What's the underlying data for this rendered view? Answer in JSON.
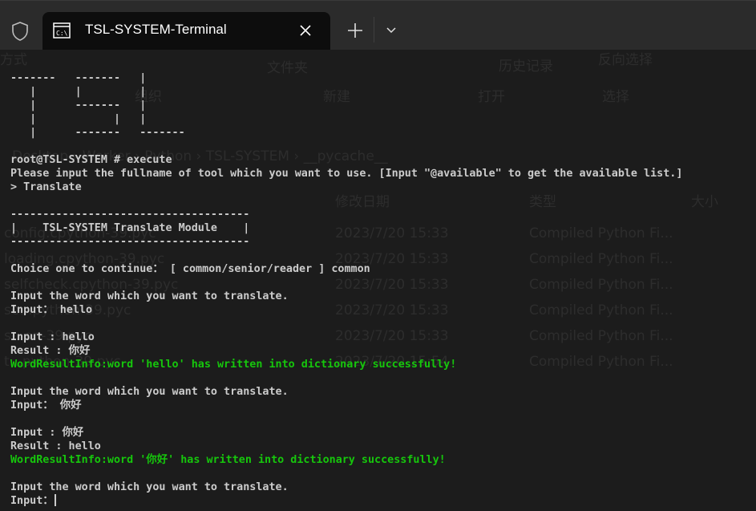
{
  "window": {
    "tab_title": "TSL-SYSTEM-Terminal",
    "tab_icon": "cmd-icon",
    "colors": {
      "green": "#16c60c",
      "text": "#cccccc",
      "background": "#1c1c1c",
      "tabbar": "#2b2b2b",
      "active_tab": "#0d0d0d"
    }
  },
  "background_window": {
    "ribbon": [
      "方式",
      "文件夹",
      "历史记录",
      "反向选择",
      "组织",
      "新建",
      "打开",
      "选择"
    ],
    "breadcrumb": "Desktop  ›  Worker  ›  Python  ›  TSL-SYSTEM  ›  __pycache__",
    "columns": [
      "修改日期",
      "类型",
      "大小"
    ],
    "files": [
      {
        "name": "config.cpython-39.pyc",
        "date": "2023/7/20 15:33",
        "type": "Compiled Python Fi..."
      },
      {
        "name": "loading.cpython-39.pyc",
        "date": "2023/7/20 15:33",
        "type": "Compiled Python Fi..."
      },
      {
        "name": "selfcheck.cpython-39.pyc",
        "date": "2023/7/20 15:33",
        "type": "Compiled Python Fi..."
      },
      {
        "name": "se...python-39.pyc",
        "date": "2023/7/20 15:33",
        "type": "Compiled Python Fi..."
      },
      {
        "name": "s...on-39.pyc",
        "date": "2023/7/20 15:33",
        "type": "Compiled Python Fi..."
      },
      {
        "name": "t...python-39.pyc",
        "date": "2023/7/20 15:54",
        "type": "Compiled Python Fi..."
      }
    ]
  },
  "terminal": {
    "lines": [
      {
        "text": "-------   -------   |",
        "color": "default"
      },
      {
        "text": "   |      |         |",
        "color": "default"
      },
      {
        "text": "   |      -------   |",
        "color": "default"
      },
      {
        "text": "   |            |   |",
        "color": "default"
      },
      {
        "text": "   |      -------   -------",
        "color": "default"
      },
      {
        "text": "",
        "color": "default"
      },
      {
        "text": "root@TSL-SYSTEM # execute",
        "color": "default"
      },
      {
        "text": "Please input the fullname of tool which you want to use. [Input \"@available\" to get the available list.]",
        "color": "default"
      },
      {
        "text": "> Translate",
        "color": "default"
      },
      {
        "text": "",
        "color": "default"
      },
      {
        "text": "-------------------------------------",
        "color": "default"
      },
      {
        "text": "|    TSL-SYSTEM Translate Module    |",
        "color": "default"
      },
      {
        "text": "-------------------------------------",
        "color": "default"
      },
      {
        "text": "",
        "color": "default"
      },
      {
        "text": "Choice one to continue： [ common/senior/reader ] common",
        "color": "default"
      },
      {
        "text": "",
        "color": "default"
      },
      {
        "text": "Input the word which you want to translate.",
        "color": "default"
      },
      {
        "text": "Input： hello",
        "color": "default"
      },
      {
        "text": "",
        "color": "default"
      },
      {
        "text": "Input : hello",
        "color": "default"
      },
      {
        "text": "Result : 你好",
        "color": "default"
      },
      {
        "text": "WordResultInfo:word 'hello' has written into dictionary successfully!",
        "color": "green"
      },
      {
        "text": "",
        "color": "default"
      },
      {
        "text": "Input the word which you want to translate.",
        "color": "default"
      },
      {
        "text": "Input： 你好",
        "color": "default"
      },
      {
        "text": "",
        "color": "default"
      },
      {
        "text": "Input : 你好",
        "color": "default"
      },
      {
        "text": "Result : hello",
        "color": "default"
      },
      {
        "text": "WordResultInfo:word '你好' has written into dictionary successfully!",
        "color": "green"
      },
      {
        "text": "",
        "color": "default"
      },
      {
        "text": "Input the word which you want to translate.",
        "color": "default"
      },
      {
        "text": "Input：",
        "color": "default",
        "cursor": true
      }
    ]
  }
}
